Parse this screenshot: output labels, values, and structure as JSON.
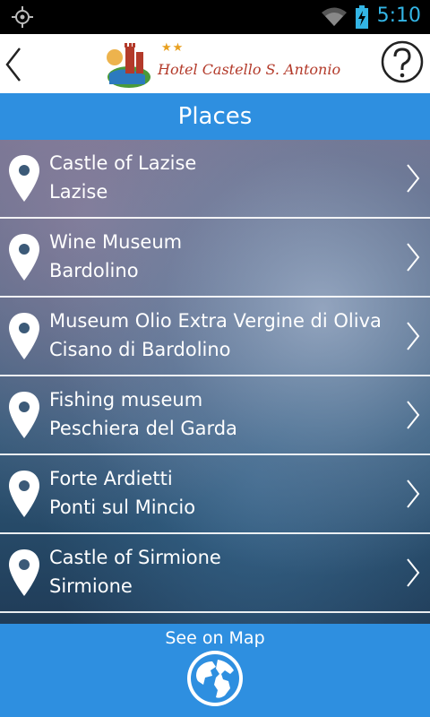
{
  "status_bar": {
    "time": "5:10",
    "icons": [
      "gps-icon",
      "wifi-icon",
      "battery-charging-icon"
    ]
  },
  "header": {
    "logo_text": "Hotel Castello S. Antonio",
    "logo_stars": "★★",
    "back_icon": "chevron-left-icon",
    "help_icon": "question-circle-icon"
  },
  "page": {
    "title": "Places"
  },
  "places": [
    {
      "name": "Castle of Lazise",
      "town": "Lazise"
    },
    {
      "name": "Wine Museum",
      "town": "Bardolino"
    },
    {
      "name": "Museum Olio Extra Vergine di Oliva",
      "town": "Cisano di Bardolino"
    },
    {
      "name": "Fishing museum",
      "town": "Peschiera del Garda"
    },
    {
      "name": "Forte Ardietti",
      "town": "Ponti sul Mincio"
    },
    {
      "name": "Castle of Sirmione",
      "town": "Sirmione"
    }
  ],
  "footer": {
    "see_on_map_label": "See on Map",
    "icon": "globe-icon"
  },
  "colors": {
    "accent": "#2e8fe0",
    "status_icon": "#33b5e5",
    "logo_red": "#b33a2a"
  }
}
